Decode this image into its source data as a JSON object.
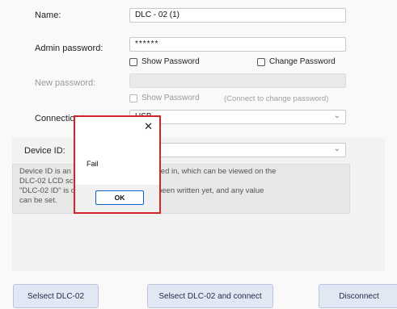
{
  "form": {
    "name_label": "Name:",
    "name_value": "DLC - 02 (1)",
    "admin_password_label": "Admin password:",
    "admin_password_value": "******",
    "show_password_1": "Show Password",
    "change_password": "Change Password",
    "new_password_label": "New password:",
    "show_password_2": "Show Password",
    "change_password_hint": "(Connect to change password)",
    "connection_type_label": "Connection type:",
    "connection_type_value": "USB"
  },
  "device": {
    "device_id_label": "Device ID:",
    "description_lines": [
      "Device ID is an option that needs to be filled in, which can be viewed on the",
      "DLC-02 LCD screen. If the",
      "\"DLC-02 ID\" is displayed, the ID has not been written yet, and any value",
      "can be set."
    ]
  },
  "buttons": {
    "select": "Selsect DLC-02",
    "select_connect": "Selsect DLC-02 and connect",
    "disconnect": "Disconnect"
  },
  "dialog": {
    "close_glyph": "✕",
    "message": "Fail",
    "ok_label": "OK"
  },
  "colors": {
    "dialog_highlight": "#d4232b",
    "ok_focus": "#0b63c7",
    "button_fill": "#e1e8f4"
  }
}
